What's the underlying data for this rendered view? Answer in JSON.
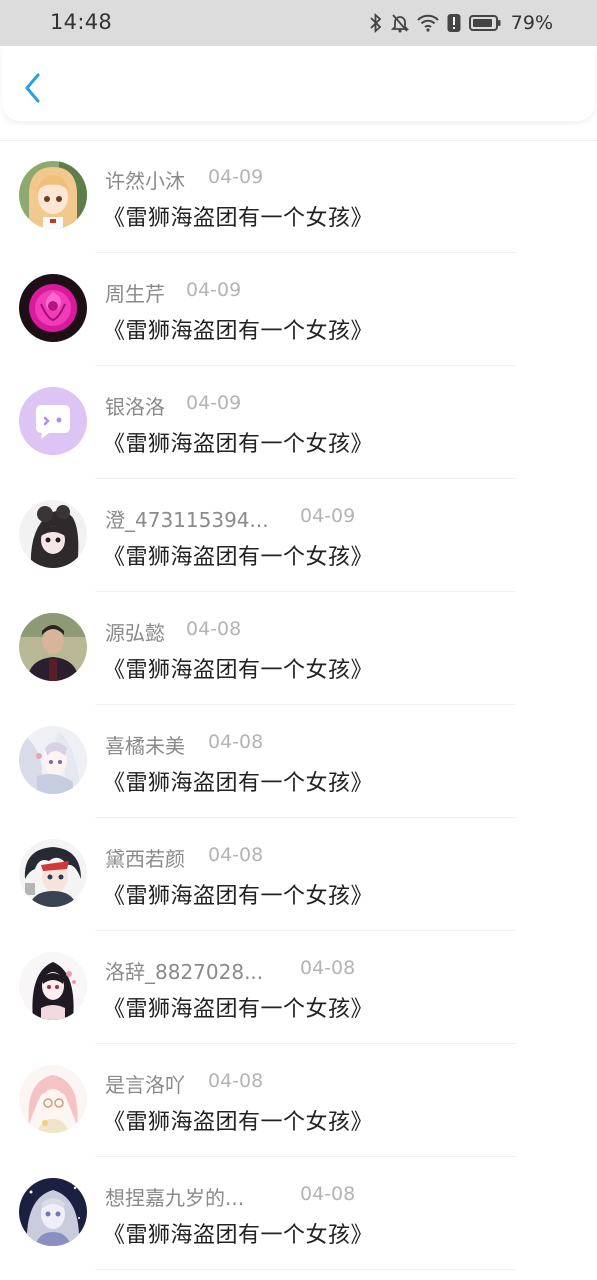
{
  "status_bar": {
    "time": "14:48",
    "battery_percent": "79%",
    "icons": [
      "bluetooth-icon",
      "bell-off-icon",
      "wifi-icon",
      "alert-icon",
      "battery-icon"
    ]
  },
  "nav": {
    "back_icon": "chevron-left-icon",
    "accent_color": "#2a9fe0"
  },
  "comments": [
    {
      "name": "许然小沐",
      "date": "04-09",
      "message": "《雷狮海盗团有一个女孩》",
      "avatar": "anime-girl-avatar"
    },
    {
      "name": "周生芹",
      "date": "04-09",
      "message": "《雷狮海盗团有一个女孩》",
      "avatar": "pink-rose-avatar"
    },
    {
      "name": "银洛洛",
      "date": "04-09",
      "message": "《雷狮海盗团有一个女孩》",
      "avatar": "default-chat-avatar"
    },
    {
      "name": "澄_473115394...",
      "date": "04-09",
      "message": "《雷狮海盗团有一个女孩》",
      "avatar": "dark-anime-avatar"
    },
    {
      "name": "源弘懿",
      "date": "04-08",
      "message": "《雷狮海盗团有一个女孩》",
      "avatar": "person-photo-avatar"
    },
    {
      "name": "喜橘未美",
      "date": "04-08",
      "message": "《雷狮海盗团有一个女孩》",
      "avatar": "pastel-anime-avatar"
    },
    {
      "name": "黛西若颜",
      "date": "04-08",
      "message": "《雷狮海盗团有一个女孩》",
      "avatar": "boy-anime-avatar"
    },
    {
      "name": "洛辞_8827028...",
      "date": "04-08",
      "message": "《雷狮海盗团有一个女孩》",
      "avatar": "black-hair-anime-avatar"
    },
    {
      "name": "是言洛吖",
      "date": "04-08",
      "message": "《雷狮海盗团有一个女孩》",
      "avatar": "pink-hair-anime-avatar"
    },
    {
      "name": "想捏嘉九岁的...",
      "date": "04-08",
      "message": "《雷狮海盗团有一个女孩》",
      "avatar": "silver-anime-avatar"
    }
  ]
}
